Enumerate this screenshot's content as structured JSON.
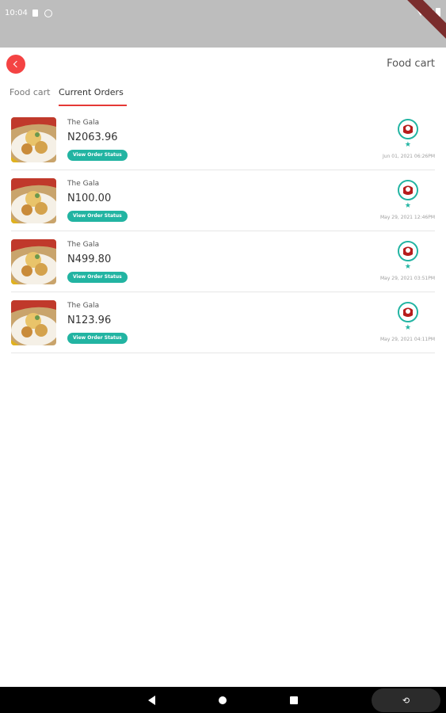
{
  "status_bar": {
    "time": "10:04"
  },
  "header": {
    "title": "Food cart"
  },
  "tabs": [
    {
      "label": "Food cart"
    },
    {
      "label": "Current Orders"
    }
  ],
  "orders": [
    {
      "restaurant": "The Gala",
      "price": "N2063.96",
      "button": "View Order Status",
      "time": "Jun 01, 2021 06:26PM"
    },
    {
      "restaurant": "The Gala",
      "price": "N100.00",
      "button": "View Order Status",
      "time": "May 29, 2021 12:46PM"
    },
    {
      "restaurant": "The Gala",
      "price": "N499.80",
      "button": "View Order Status",
      "time": "May 29, 2021 03:51PM"
    },
    {
      "restaurant": "The Gala",
      "price": "N123.96",
      "button": "View Order Status",
      "time": "May 29, 2021 04:11PM"
    }
  ],
  "colors": {
    "accent_red": "#f44343",
    "teal": "#22b4a2"
  },
  "icons": {
    "back": "chevron-left-icon",
    "star": "star-icon"
  }
}
